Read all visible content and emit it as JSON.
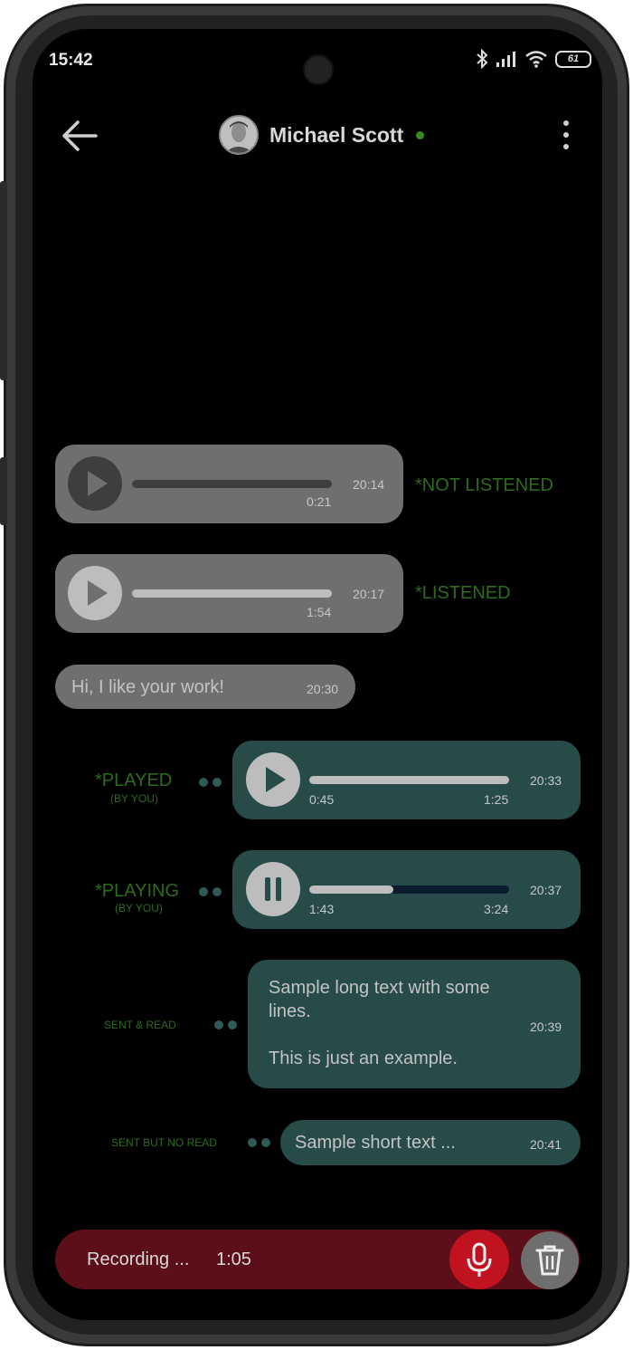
{
  "status_bar": {
    "time": "15:42",
    "battery": "61"
  },
  "header": {
    "contact_name": "Michael Scott"
  },
  "messages": [
    {
      "type": "voice",
      "direction": "incoming",
      "time": "20:14",
      "duration": "0:21",
      "status_label": "*NOT LISTENED",
      "progress": 0
    },
    {
      "type": "voice",
      "direction": "incoming",
      "time": "20:17",
      "duration": "1:54",
      "status_label": "*LISTENED",
      "progress": 1
    },
    {
      "type": "text",
      "direction": "incoming",
      "text": "Hi, I like your work!",
      "time": "20:30"
    },
    {
      "type": "voice",
      "direction": "outgoing",
      "time": "20:33",
      "position": "0:45",
      "duration": "1:25",
      "status_label": "*PLAYED",
      "status_sub": "(BY YOU)",
      "progress": 1
    },
    {
      "type": "voice",
      "direction": "outgoing",
      "time": "20:37",
      "position": "1:43",
      "duration": "3:24",
      "status_label": "*PLAYING",
      "status_sub": "(BY YOU)",
      "progress": 0.42
    },
    {
      "type": "text",
      "direction": "outgoing",
      "text_line1": "Sample long text with some",
      "text_line2": "lines.",
      "text_line3": "This is just an example.",
      "time": "20:39",
      "status_label": "SENT & READ"
    },
    {
      "type": "text",
      "direction": "outgoing",
      "text": "Sample short text ...",
      "time": "20:41",
      "status_label": "SENT BUT NO READ"
    }
  ],
  "recorder": {
    "label": "Recording ...",
    "time": "1:05"
  },
  "colors": {
    "incoming_bubble": "#6f6f6f",
    "outgoing_bubble": "#264b48",
    "status_label": "#2e6b1e",
    "recording_bar": "#5c0f19",
    "mic_button": "#c0121f"
  }
}
